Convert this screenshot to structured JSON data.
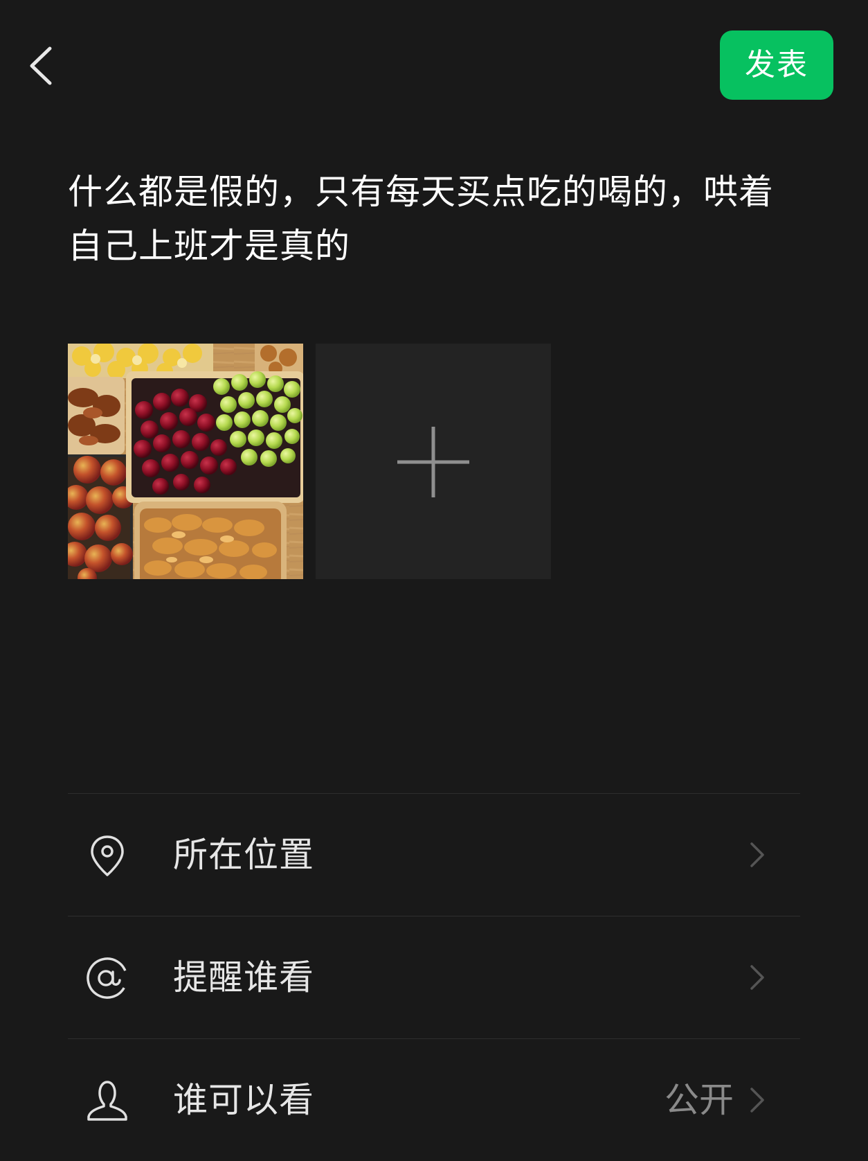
{
  "header": {
    "back_icon": "chevron-left-icon",
    "post_label": "发表",
    "post_color": "#07c160"
  },
  "composer": {
    "text": "什么都是假的，只有每天买点吃的喝的，哄着自己上班才是真的"
  },
  "photos": {
    "thumbnail": "fruit-snack-tray-photo",
    "add_icon": "plus-icon"
  },
  "options": [
    {
      "icon": "location-pin-icon",
      "label": "所在位置",
      "value": ""
    },
    {
      "icon": "at-sign-icon",
      "label": "提醒谁看",
      "value": ""
    },
    {
      "icon": "person-icon",
      "label": "谁可以看",
      "value": "公开"
    }
  ]
}
